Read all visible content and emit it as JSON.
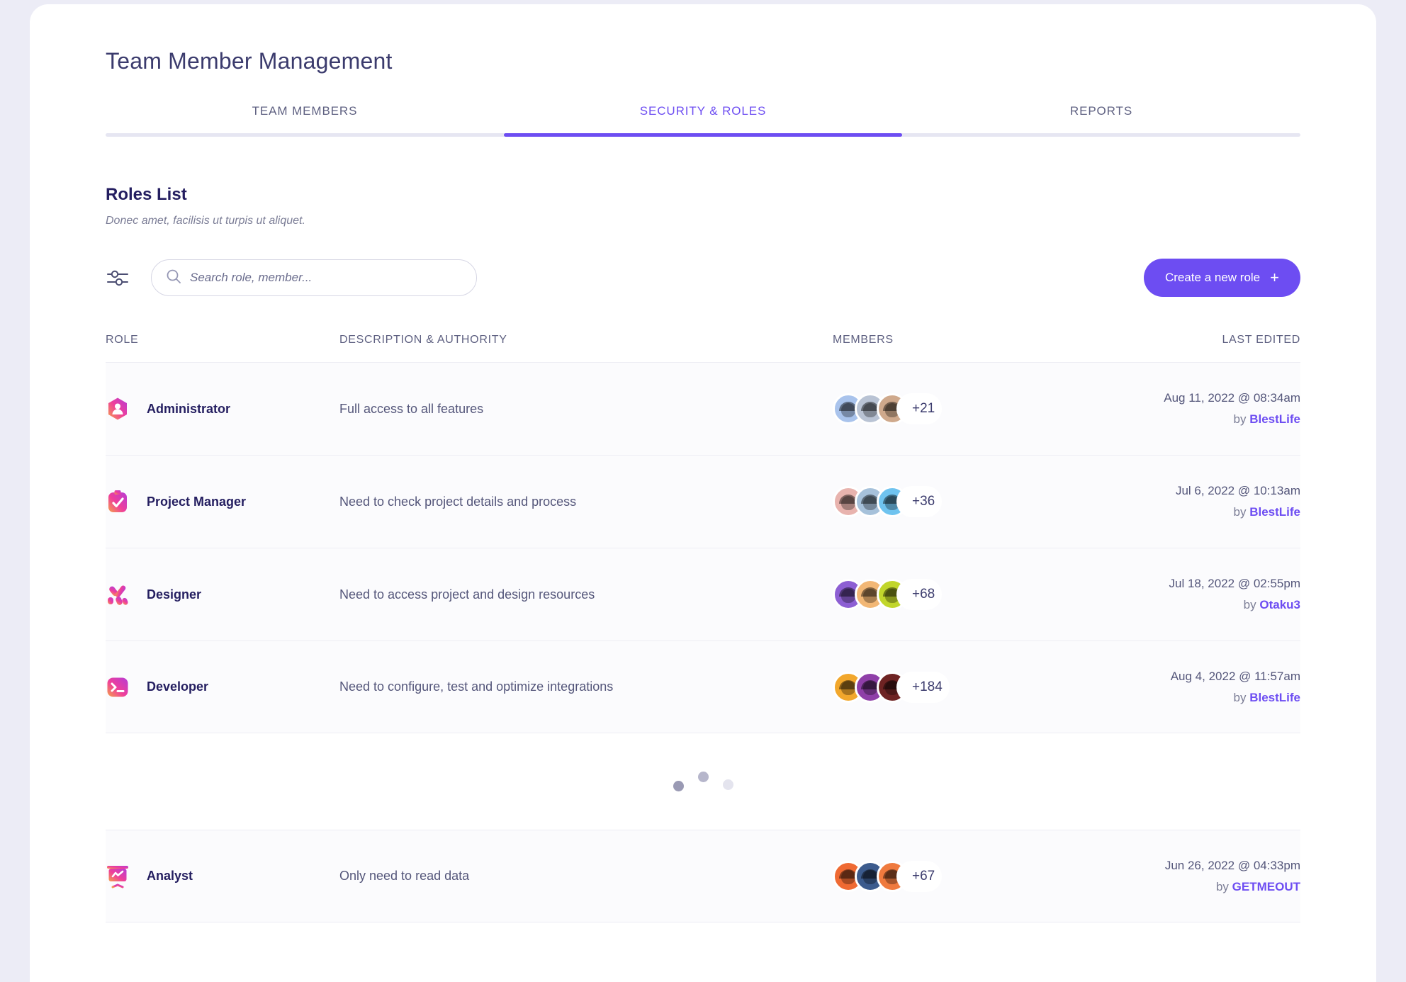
{
  "page": {
    "title": "Team Member Management"
  },
  "tabs": [
    {
      "label": "TEAM MEMBERS",
      "active": false
    },
    {
      "label": "SECURITY & ROLES",
      "active": true
    },
    {
      "label": "REPORTS",
      "active": false
    }
  ],
  "section": {
    "title": "Roles List",
    "subtitle": "Donec amet, facilisis ut turpis ut aliquet."
  },
  "toolbar": {
    "filter_icon": "sliders-filter-icon",
    "search_placeholder": "Search role, member...",
    "search_value": "",
    "search_icon": "search-icon",
    "create_label": "Create a new role",
    "create_plus": "+",
    "accent_color": "#6d4df2"
  },
  "table": {
    "headers": {
      "role": "ROLE",
      "description": "DESCRIPTION & AUTHORITY",
      "members": "MEMBERS",
      "last_edited": "LAST EDITED"
    },
    "rows": [
      {
        "icon": "administrator-hexagon-person-icon",
        "role": "Administrator",
        "description": "Full access to all features",
        "member_count": "+21",
        "avatar_colors": [
          "#a9c3ec",
          "#b9c3d4",
          "#cfa98c"
        ],
        "date": "Aug 11, 2022 @ 08:34am",
        "by_prefix": "by ",
        "by_user": "BlestLife"
      },
      {
        "icon": "project-manager-clipboard-check-icon",
        "role": "Project Manager",
        "description": "Need to check project details and process",
        "member_count": "+36",
        "avatar_colors": [
          "#e8b3ae",
          "#a6c1da",
          "#6fc3ef"
        ],
        "date": "Jul 6, 2022 @ 10:13am",
        "by_prefix": "by ",
        "by_user": "BlestLife"
      },
      {
        "icon": "designer-brush-strokes-icon",
        "role": "Designer",
        "description": "Need to access project and design resources",
        "member_count": "+68",
        "avatar_colors": [
          "#8d5fd3",
          "#f2b775",
          "#c1d62b"
        ],
        "date": "Jul 18, 2022 @ 02:55pm",
        "by_prefix": "by ",
        "by_user": "Otaku3"
      },
      {
        "icon": "developer-terminal-prompt-icon",
        "role": "Developer",
        "description": "Need to configure, test and optimize integrations",
        "member_count": "+184",
        "avatar_colors": [
          "#f2a72c",
          "#8f3fa8",
          "#6e2323"
        ],
        "date": "Aug 4, 2022 @ 11:57am",
        "by_prefix": "by ",
        "by_user": "BlestLife"
      }
    ],
    "loader": {
      "name": "loading-dots",
      "dots": 3
    },
    "rows_after_loader": [
      {
        "icon": "analyst-presentation-chart-icon",
        "role": "Analyst",
        "description": "Only need to read data",
        "member_count": "+67",
        "avatar_colors": [
          "#ef6a33",
          "#3c5b8d",
          "#ef7a3e"
        ],
        "date": "Jun 26, 2022 @ 04:33pm",
        "by_prefix": "by ",
        "by_user": "GETMEOUT"
      }
    ]
  }
}
